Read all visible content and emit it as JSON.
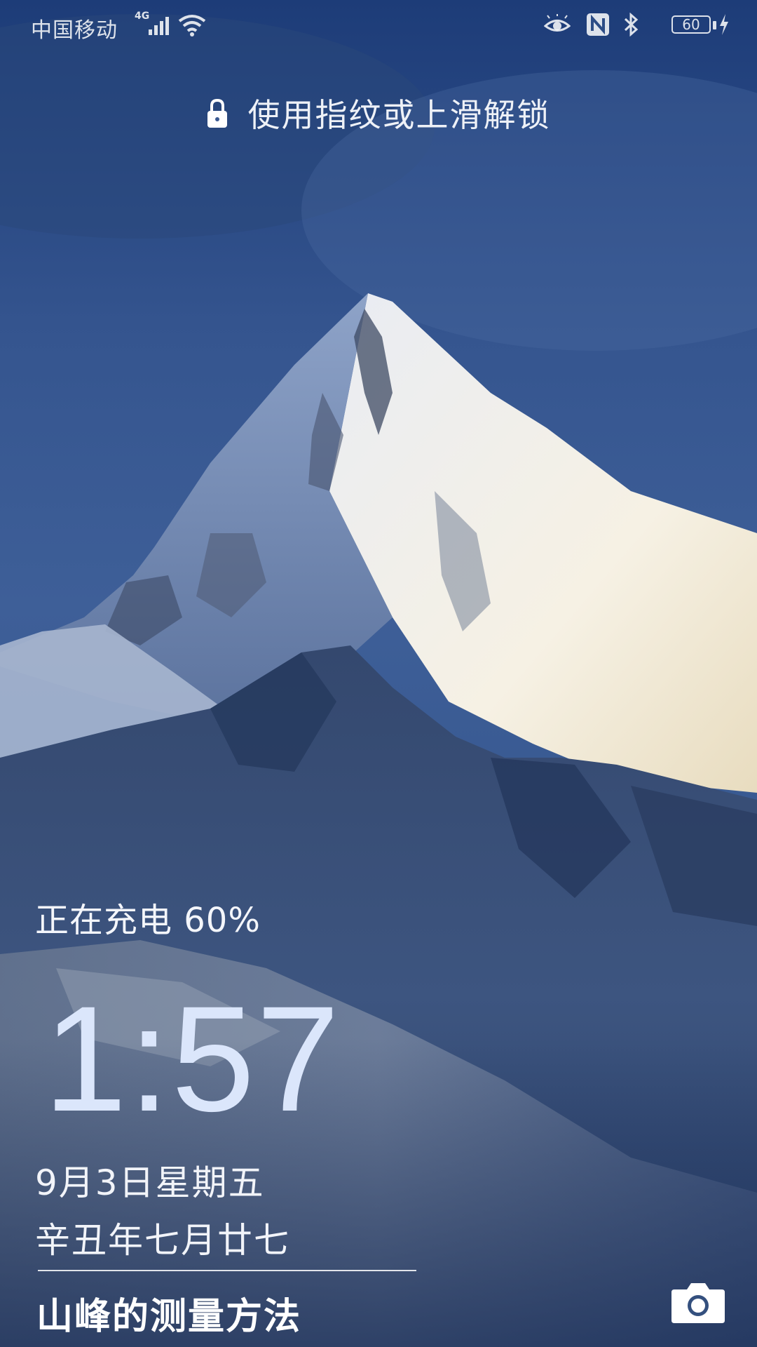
{
  "status_bar": {
    "carrier": "中国移动",
    "network_type": "4G",
    "battery_percent": "60",
    "icons": [
      "signal-icon",
      "wifi-icon",
      "eye-comfort-icon",
      "nfc-icon",
      "bluetooth-icon",
      "battery-icon",
      "charging-bolt-icon"
    ]
  },
  "lock_screen": {
    "unlock_hint": "使用指纹或上滑解锁",
    "charging_status": "正在充电 60%",
    "time": "1:57",
    "date": "9月3日星期五",
    "lunar_date": "辛丑年七月廿七",
    "story_title": "山峰的测量方法",
    "camera_icon": "camera-icon"
  },
  "colors": {
    "sky_top": "#1f3f7a",
    "sky_mid": "#3b5a90",
    "clock": "#dbe6fb",
    "snow": "#f3f1ea",
    "rock": "#233552"
  }
}
